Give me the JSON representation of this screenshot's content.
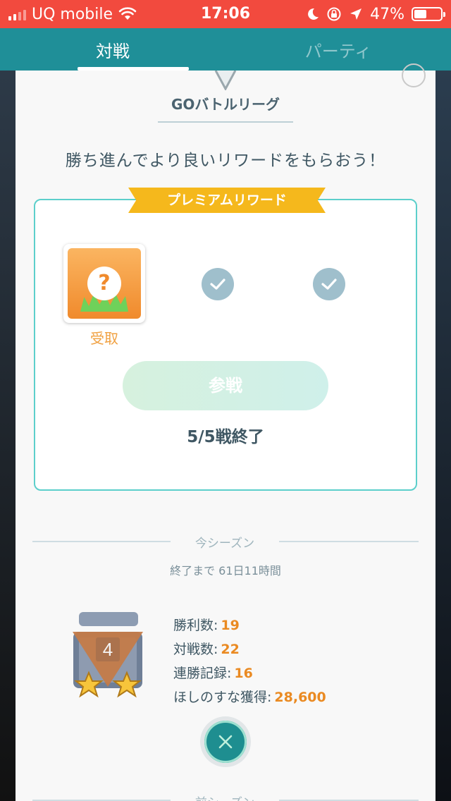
{
  "status_bar": {
    "carrier": "UQ mobile",
    "time": "17:06",
    "battery_percent": "47%",
    "battery_level": 0.47,
    "icons": [
      "signal-icon",
      "wifi-icon",
      "moon-icon",
      "orientation-lock-icon",
      "location-icon",
      "battery-icon"
    ]
  },
  "tabs": [
    {
      "label": "対戦",
      "active": true
    },
    {
      "label": "パーティ",
      "active": false
    }
  ],
  "league": {
    "title": "GOバトルリーグ",
    "tagline": "勝ち進んでより良いリワードをもらおう！"
  },
  "reward": {
    "ribbon": "プレミアムリワード",
    "item_icon": "question-mark-grass-icon",
    "item_symbol": "?",
    "item_label": "受取",
    "checks": [
      "check-icon",
      "check-icon"
    ],
    "join_button": "参戦",
    "battles_done": "5/5戦終了"
  },
  "season": {
    "label": "今シーズン",
    "remaining": "終了まで 61日11時間",
    "rank": "4",
    "stars": 2,
    "stats": [
      {
        "label": "勝利数:",
        "value": "19"
      },
      {
        "label": "対戦数:",
        "value": "22"
      },
      {
        "label": "連勝記録:",
        "value": "16"
      },
      {
        "label": "ほしのすな獲得:",
        "value": "28,600"
      }
    ]
  },
  "close_icon": "close-icon",
  "previous_season": {
    "label": "前シーズン"
  },
  "colors": {
    "status_bar": "#f24a3e",
    "tab_bar": "#1f8f98",
    "ribbon": "#f5b81c",
    "accent_orange": "#ea8a22",
    "teal_border": "#5ccfcb"
  }
}
